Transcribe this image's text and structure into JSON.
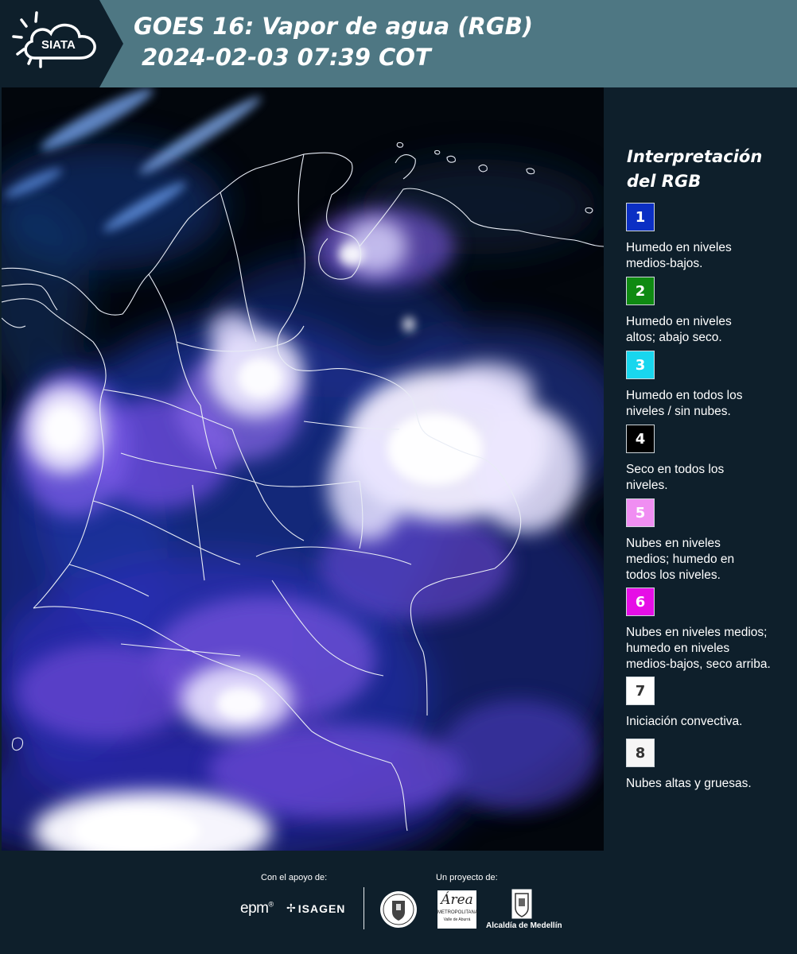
{
  "header": {
    "logo_text": "SIATA",
    "title_line1": "GOES 16: Vapor de agua (RGB)",
    "title_line2": "2024-02-03 07:39 COT"
  },
  "legend": {
    "title_line1": "Interpretación",
    "title_line2": "del RGB",
    "items": [
      {
        "number": "1",
        "color": "#0b2fc4",
        "text_color": "#ffffff",
        "desc_lines": [
          "Humedo en niveles",
          "medios-bajos."
        ]
      },
      {
        "number": "2",
        "color": "#0f8a12",
        "text_color": "#ffffff",
        "desc_lines": [
          "Humedo en niveles",
          "altos; abajo seco."
        ]
      },
      {
        "number": "3",
        "color": "#19d6ee",
        "text_color": "#ffffff",
        "desc_lines": [
          "Humedo en todos los",
          "niveles / sin nubes."
        ]
      },
      {
        "number": "4",
        "color": "#000000",
        "text_color": "#ffffff",
        "desc_lines": [
          "Seco en todos los",
          "niveles."
        ]
      },
      {
        "number": "5",
        "color": "#f08ef2",
        "text_color": "#ffffff",
        "desc_lines": [
          "Nubes en niveles",
          "medios; humedo en",
          "todos los niveles."
        ]
      },
      {
        "number": "6",
        "color": "#e60ee6",
        "text_color": "#ffffff",
        "desc_lines": [
          "Nubes en niveles medios;",
          "humedo en niveles",
          "medios-bajos, seco arriba."
        ]
      },
      {
        "number": "7",
        "color": "#ffffff",
        "text_color": "#333333",
        "desc_lines": [
          "Iniciación convectiva."
        ]
      },
      {
        "number": "8",
        "color": "#f6f6f6",
        "text_color": "#333333",
        "desc_lines": [
          "Nubes altas y gruesas."
        ]
      }
    ]
  },
  "footer": {
    "support_label": "Con el apoyo de:",
    "project_label": "Un proyecto de:",
    "sponsors": {
      "epm": "epm",
      "isagen": "ISAGEN",
      "area_metropolitana_script": "Área",
      "area_metropolitana": "METROPOLITANA",
      "area_metropolitana_sub": "Valle de Aburrá",
      "alcaldia": "Alcaldía de Medellín"
    }
  }
}
